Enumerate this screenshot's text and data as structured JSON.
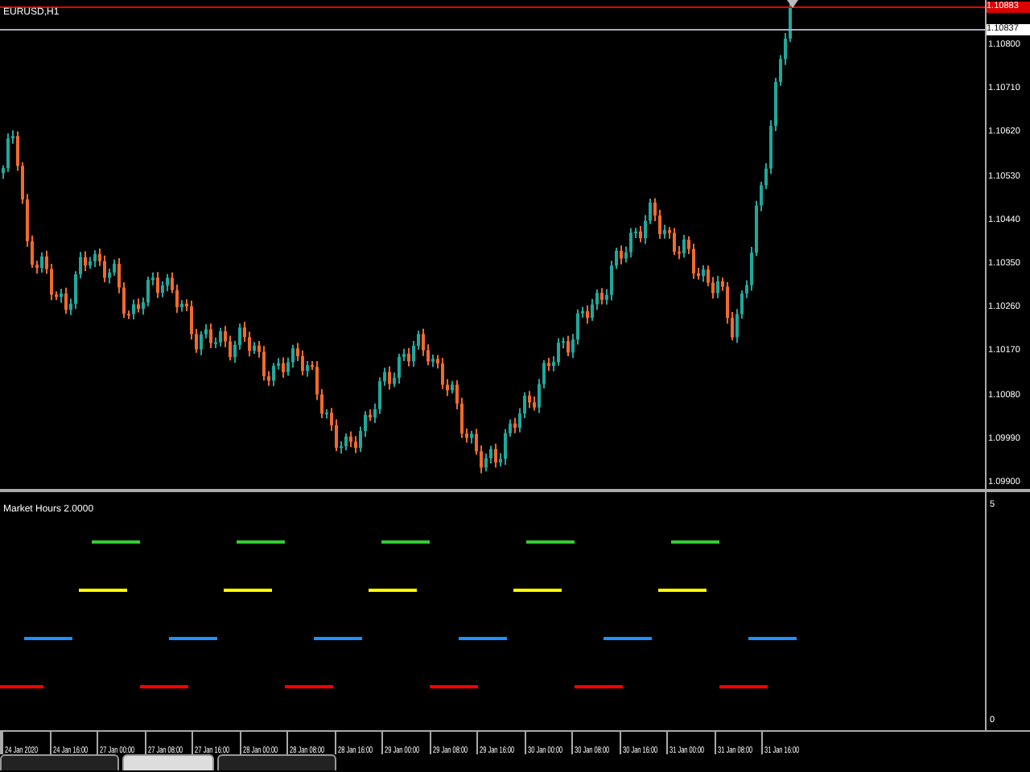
{
  "chart": {
    "title": "EURUSD,H1",
    "ask_price": "1.10883",
    "bid_price": "1.10837",
    "price_labels": [
      "1.10800",
      "1.10710",
      "1.10620",
      "1.10530",
      "1.10440",
      "1.10350",
      "1.10260",
      "1.10170",
      "1.10080",
      "1.09990",
      "1.09900"
    ]
  },
  "indicator": {
    "title": "Market Hours 2.0000",
    "scale_max": "5",
    "scale_min": "0",
    "sessions": [
      {
        "color": "#33cc33"
      },
      {
        "color": "#ffff00"
      },
      {
        "color": "#1e90ff"
      },
      {
        "color": "#ff0000"
      }
    ]
  },
  "time_axis": {
    "labels": [
      "24 Jan 2020",
      "24 Jan 16:00",
      "27 Jan 00:00",
      "27 Jan 08:00",
      "27 Jan 16:00",
      "28 Jan 00:00",
      "28 Jan 08:00",
      "28 Jan 16:00",
      "29 Jan 00:00",
      "29 Jan 08:00",
      "29 Jan 16:00",
      "30 Jan 00:00",
      "30 Jan 08:00",
      "30 Jan 16:00",
      "31 Jan 00:00",
      "31 Jan 08:00",
      "31 Jan 16:00"
    ]
  },
  "tabs": [
    {
      "selected": false
    },
    {
      "selected": true
    },
    {
      "selected": false
    }
  ]
}
